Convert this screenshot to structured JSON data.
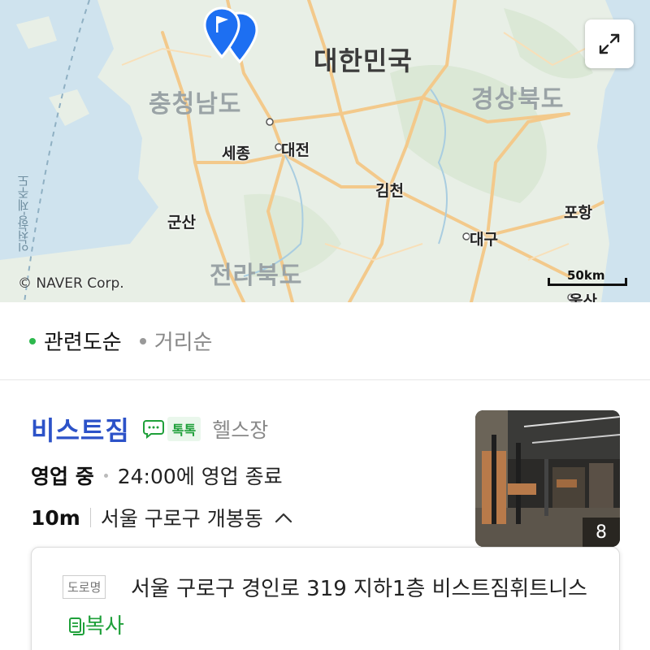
{
  "map": {
    "country": "대한민국",
    "provinces": [
      "충청남도",
      "경상북도",
      "전라북도"
    ],
    "cities": [
      "세종",
      "대전",
      "김천",
      "포항",
      "군산",
      "대구",
      "울산"
    ],
    "sea_label": "인천항-제주도",
    "copyright": "© NAVER Corp.",
    "scale": "50km",
    "expand_icon": "expand-arrows-icon",
    "pin_icon": "flag-pin-icon",
    "colors": {
      "water": "#cfe3ee",
      "land": "#e8efe6",
      "road": "#f3c98b",
      "pin": "#1d6ff2"
    }
  },
  "sort": {
    "options": [
      {
        "label": "관련도순",
        "active": true,
        "color": "#2db84d"
      },
      {
        "label": "거리순",
        "active": false,
        "color": "#999999"
      }
    ]
  },
  "result": {
    "name": "비스트짐",
    "talk_label": "톡톡",
    "category": "헬스장",
    "status": "영업 중",
    "close_info": "24:00에 영업 종료",
    "distance": "10m",
    "address_short": "서울 구로구 개봉동",
    "photo_count": "8",
    "road_tag": "도로명",
    "address_full": "서울 구로구 경인로 319 지하1층 비스트짐휘트니스",
    "copy_label": "복사",
    "colors": {
      "name": "#2c52c8",
      "talk": "#1fa03a"
    }
  }
}
